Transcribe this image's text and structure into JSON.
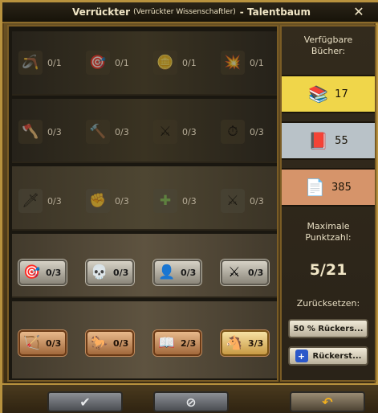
{
  "window": {
    "title_main": "Verrückter",
    "title_sub": "(Verrückter Wissenschaftler)",
    "title_tail": "- Talentbaum"
  },
  "tree": {
    "rows": [
      {
        "talents": [
          {
            "icon": "boomerang-icon",
            "glyph": "🪃",
            "value": "0/1"
          },
          {
            "icon": "soldier-target-icon",
            "glyph": "🎯",
            "value": "0/1"
          },
          {
            "icon": "coin-plus-icon",
            "glyph": "🪙",
            "value": "0/1"
          },
          {
            "icon": "heart-burst-icon",
            "glyph": "💥",
            "value": "0/1"
          }
        ]
      },
      {
        "talents": [
          {
            "icon": "axe-icon",
            "glyph": "🪓",
            "value": "0/3"
          },
          {
            "icon": "hammer-soldier-icon",
            "glyph": "🔨",
            "value": "0/3"
          },
          {
            "icon": "crossed-swords-soldier-icon",
            "glyph": "⚔",
            "value": "0/3"
          },
          {
            "icon": "swords-clock-icon",
            "glyph": "⏱",
            "value": "0/3"
          }
        ]
      },
      {
        "talents": [
          {
            "icon": "spear-icon",
            "glyph": "🗡",
            "value": "0/3"
          },
          {
            "icon": "fist-icon",
            "glyph": "✊",
            "value": "0/3"
          },
          {
            "icon": "star-plus-icon",
            "glyph": "✚",
            "value": "0/3"
          },
          {
            "icon": "swords-plus-icon",
            "glyph": "⚔",
            "value": "0/3"
          }
        ]
      },
      {
        "talents": [
          {
            "icon": "target-arrow-icon",
            "glyph": "🎯",
            "value": "0/3"
          },
          {
            "icon": "skull-heart-icon",
            "glyph": "💀",
            "value": "0/3"
          },
          {
            "icon": "warrior-plus-icon",
            "glyph": "👤",
            "value": "0/3"
          },
          {
            "icon": "sword-boot-icon",
            "glyph": "⚔",
            "value": "0/3"
          }
        ]
      },
      {
        "talents": [
          {
            "icon": "archer-shield-icon",
            "glyph": "🏹",
            "value": "0/3"
          },
          {
            "icon": "horse-red-icon",
            "glyph": "🐎",
            "value": "0/3"
          },
          {
            "icon": "book-plus-icon",
            "glyph": "📖",
            "value": "2/3"
          },
          {
            "icon": "horse-gold-icon",
            "glyph": "🐴",
            "value": "3/3"
          }
        ]
      }
    ]
  },
  "side": {
    "books_label": "Verfügbare Bücher:",
    "books": [
      {
        "icon": "gold-book-icon",
        "glyph": "📚",
        "count": "17",
        "color": "#f0d64a"
      },
      {
        "icon": "red-book-icon",
        "glyph": "📕",
        "count": "55",
        "color": "#b9c2c8"
      },
      {
        "icon": "white-book-icon",
        "glyph": "📄",
        "count": "385",
        "color": "#d6946a"
      }
    ],
    "max_label": "Maximale Punktzahl:",
    "points": "5/21",
    "reset_label": "Zurücksetzen:",
    "reset50_label": "50 % Rückers...",
    "reset_full_label": "Rückerst..."
  },
  "footer": {
    "confirm_glyph": "✔",
    "cancel_glyph": "⊘",
    "undo_glyph": "↶"
  }
}
